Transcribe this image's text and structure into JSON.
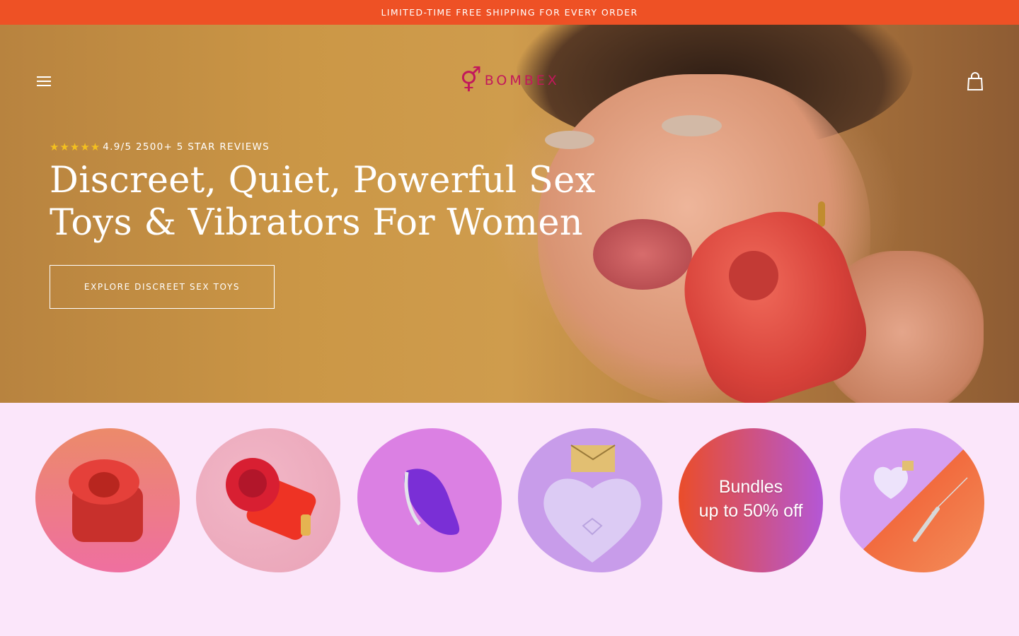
{
  "announcement": {
    "text": "LIMITED-TIME FREE SHIPPING FOR EVERY ORDER"
  },
  "header": {
    "menu_icon": "hamburger-menu-icon",
    "logo_text": "BOMBEX",
    "cart_icon": "shopping-bag-icon"
  },
  "hero": {
    "stars": "★★★★★",
    "rating_text": "4.9/5 2500+ 5 STAR REVIEWS",
    "headline_line1": "Discreet, Quiet, Powerful Sex",
    "headline_line2": "Toys & Vibrators For Women",
    "cta_label": "EXPLORE DISCREET SEX TOYS"
  },
  "categories": [
    {
      "id": "rose-lips-toy",
      "label": "",
      "color_top": "#ec8a6a",
      "color_bottom": "#ef6fa0"
    },
    {
      "id": "rose-toy",
      "label": "",
      "color_top": "#e9a3b7",
      "color_bottom": "#f2b7c7"
    },
    {
      "id": "purple-suction-toy",
      "label": "",
      "color_top": "#d77de0",
      "color_bottom": "#e08ae4"
    },
    {
      "id": "heart-perfume-toy",
      "label": "",
      "color_top": "#c49ae8",
      "color_bottom": "#d2a7ec"
    },
    {
      "id": "bundles",
      "label_line1": "Bundles",
      "label_line2": "up to 50% off",
      "color_left": "#ea4d2a",
      "color_right": "#b457d6"
    },
    {
      "id": "necklace-toy",
      "label": "",
      "color_top": "#d59ff0",
      "color_bottom": "#f26b3e"
    }
  ],
  "colors": {
    "announcement_bg": "#ee5125",
    "brand": "#c2185b",
    "section_bg": "#fbe6fa"
  }
}
